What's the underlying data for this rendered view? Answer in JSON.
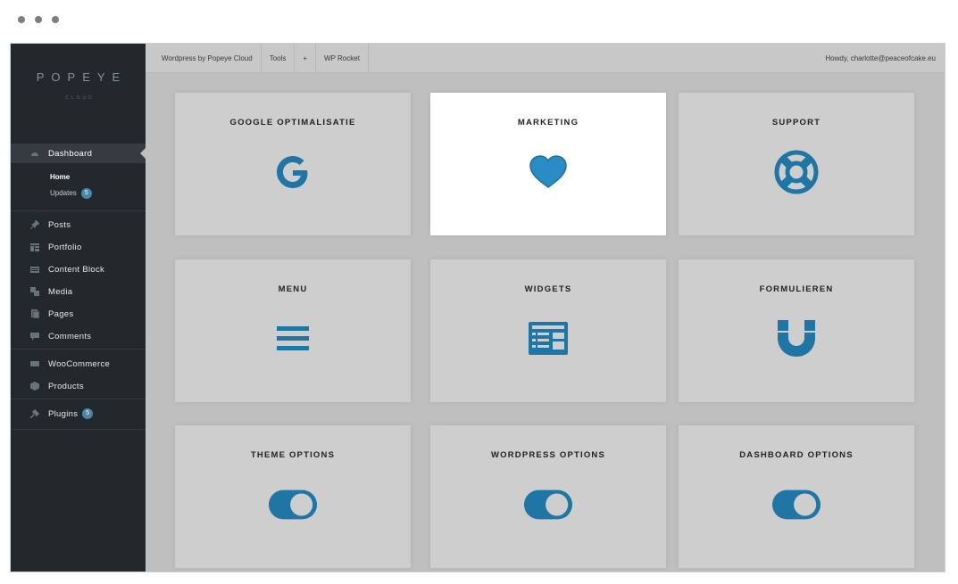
{
  "logo": {
    "text": "POPEYE",
    "subtext": "CLOUD"
  },
  "sidebar": {
    "items": [
      {
        "label": "Dashboard",
        "icon": "dashboard-icon"
      },
      {
        "label": "Posts",
        "icon": "pin-icon"
      },
      {
        "label": "Portfolio",
        "icon": "portfolio-icon"
      },
      {
        "label": "Content Block",
        "icon": "content-block-icon"
      },
      {
        "label": "Media",
        "icon": "media-icon"
      },
      {
        "label": "Pages",
        "icon": "pages-icon"
      },
      {
        "label": "Comments",
        "icon": "comment-icon"
      },
      {
        "label": "WooCommerce",
        "icon": "woocommerce-icon"
      },
      {
        "label": "Products",
        "icon": "products-icon"
      },
      {
        "label": "Plugins",
        "icon": "plugin-icon",
        "badge": "5"
      }
    ],
    "subitems": [
      {
        "label": "Home"
      },
      {
        "label": "Updates",
        "badge": "5"
      }
    ]
  },
  "topbar": {
    "items": [
      {
        "label": "Wordpress by Popeye Cloud"
      },
      {
        "label": "Tools"
      },
      {
        "label": "+"
      },
      {
        "label": "WP Rocket"
      }
    ],
    "howdy": "Howdy, charlotte@peaceofcake.eu"
  },
  "tiles": [
    {
      "title": "GOOGLE OPTIMALISATIE",
      "icon": "google-icon"
    },
    {
      "title": "MARKETING",
      "icon": "heart-icon"
    },
    {
      "title": "SUPPORT",
      "icon": "lifebuoy-icon"
    },
    {
      "title": "MENU",
      "icon": "hamburger-menu-icon"
    },
    {
      "title": "WIDGETS",
      "icon": "widgets-icon"
    },
    {
      "title": "FORMULIEREN",
      "icon": "magnet-icon"
    },
    {
      "title": "THEME OPTIONS",
      "icon": "toggle-icon"
    },
    {
      "title": "WORDPRESS OPTIONS",
      "icon": "toggle-icon"
    },
    {
      "title": "DASHBOARD OPTIONS",
      "icon": "toggle-icon"
    }
  ],
  "colors": {
    "accent": "#1f75a4",
    "accent_light": "#2a8cc4",
    "sidebar_bg": "#23282d"
  }
}
